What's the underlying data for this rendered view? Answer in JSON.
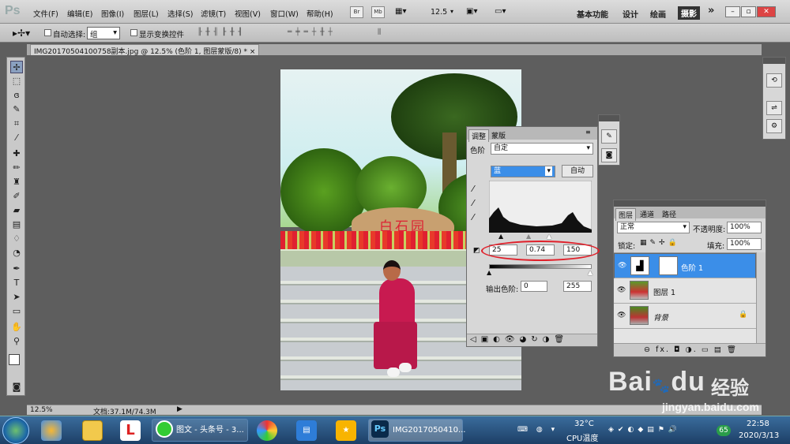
{
  "app": {
    "logo": "Ps"
  },
  "menu": [
    "文件(F)",
    "编辑(E)",
    "图像(I)",
    "图层(L)",
    "选择(S)",
    "滤镜(T)",
    "视图(V)",
    "窗口(W)",
    "帮助(H)"
  ],
  "menubar_buttons": [
    "Br",
    "Mb"
  ],
  "zoom_select": "12.5",
  "workspaces": [
    "基本功能",
    "设计",
    "绘画",
    "摄影"
  ],
  "workspace_more": "»",
  "options": {
    "auto_select_label": "自动选择:",
    "auto_select_value": "组",
    "show_transform": "显示变换控件"
  },
  "document_tab": {
    "title": "IMG20170504100758副本.jpg @ 12.5% (色阶 1, 图层蒙版/8) *",
    "close": "×"
  },
  "photo": {
    "rock_text": "白石园"
  },
  "status": {
    "zoom": "12.5%",
    "doc": "文档:37.1M/74.3M"
  },
  "adjust_panel": {
    "tabs": [
      "调整",
      "蒙版"
    ],
    "type_label": "色阶",
    "preset": "自定",
    "channel": "蓝",
    "auto_label": "自动",
    "input_levels": [
      "25",
      "0.74",
      "150"
    ],
    "output_label": "输出色阶:",
    "output_levels": [
      "0",
      "255"
    ]
  },
  "layers_panel": {
    "tabs": [
      "图层",
      "通道",
      "路径"
    ],
    "blend_mode": "正常",
    "opacity_label": "不透明度:",
    "opacity": "100%",
    "lock_label": "锁定:",
    "fill_label": "填充:",
    "fill": "100%",
    "layers": [
      {
        "name": "色阶 1",
        "selected": true
      },
      {
        "name": "图层 1",
        "selected": false
      },
      {
        "name": "背景",
        "selected": false
      }
    ],
    "footer_icons": "⊖ fx. ◘ ◑. ▭ ▤ 🗑"
  },
  "taskbar": {
    "apps": [
      "图文 - 头条号 - 3...",
      "IMG2017050410..."
    ],
    "temp": "32°C",
    "temp_label": "CPU温度",
    "time": "22:58",
    "date": "2020/3/13",
    "badge": "65"
  },
  "watermark": {
    "logo": "Bai",
    "logo2": "du",
    "cn": "经验",
    "url": "jingyan.baidu.com"
  },
  "colors": {
    "selection": "#3b8ee8",
    "annotation": "#e0202a"
  }
}
